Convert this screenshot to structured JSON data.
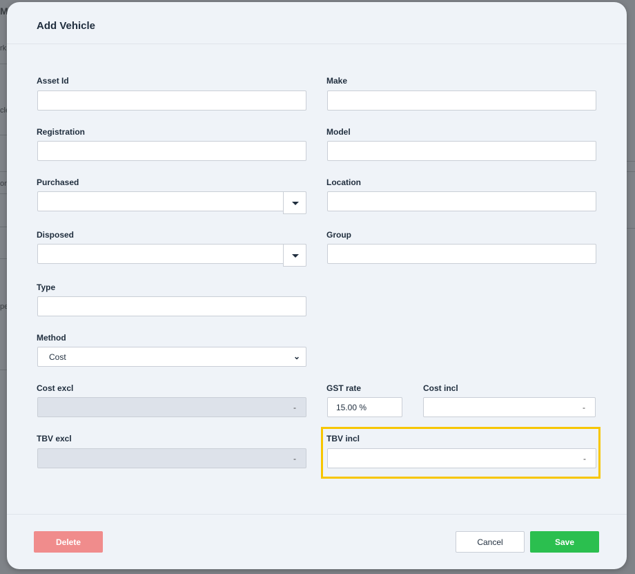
{
  "modal": {
    "title": "Add Vehicle"
  },
  "background": {
    "fragments": [
      "M",
      "rk",
      "cle",
      "or",
      "pe"
    ]
  },
  "form": {
    "asset_id": {
      "label": "Asset Id",
      "value": ""
    },
    "make": {
      "label": "Make",
      "value": ""
    },
    "registration": {
      "label": "Registration",
      "value": ""
    },
    "model": {
      "label": "Model",
      "value": ""
    },
    "purchased": {
      "label": "Purchased",
      "value": ""
    },
    "location": {
      "label": "Location",
      "value": ""
    },
    "disposed": {
      "label": "Disposed",
      "value": ""
    },
    "group": {
      "label": "Group",
      "value": ""
    },
    "type": {
      "label": "Type",
      "value": ""
    },
    "method": {
      "label": "Method",
      "value": "Cost"
    },
    "cost_excl": {
      "label": "Cost excl",
      "value": "-"
    },
    "gst_rate": {
      "label": "GST rate",
      "value": "15.00 %"
    },
    "cost_incl": {
      "label": "Cost incl",
      "value": "-"
    },
    "tbv_excl": {
      "label": "TBV excl",
      "value": "-"
    },
    "tbv_incl": {
      "label": "TBV incl",
      "value": "-"
    }
  },
  "footer": {
    "delete_label": "Delete",
    "cancel_label": "Cancel",
    "save_label": "Save"
  },
  "colors": {
    "highlight": "#f7c600",
    "save": "#2bbf4f",
    "delete": "#f08c8c"
  },
  "icons": {
    "dropdown": "caret-down-icon",
    "select": "chevron-down-icon"
  }
}
